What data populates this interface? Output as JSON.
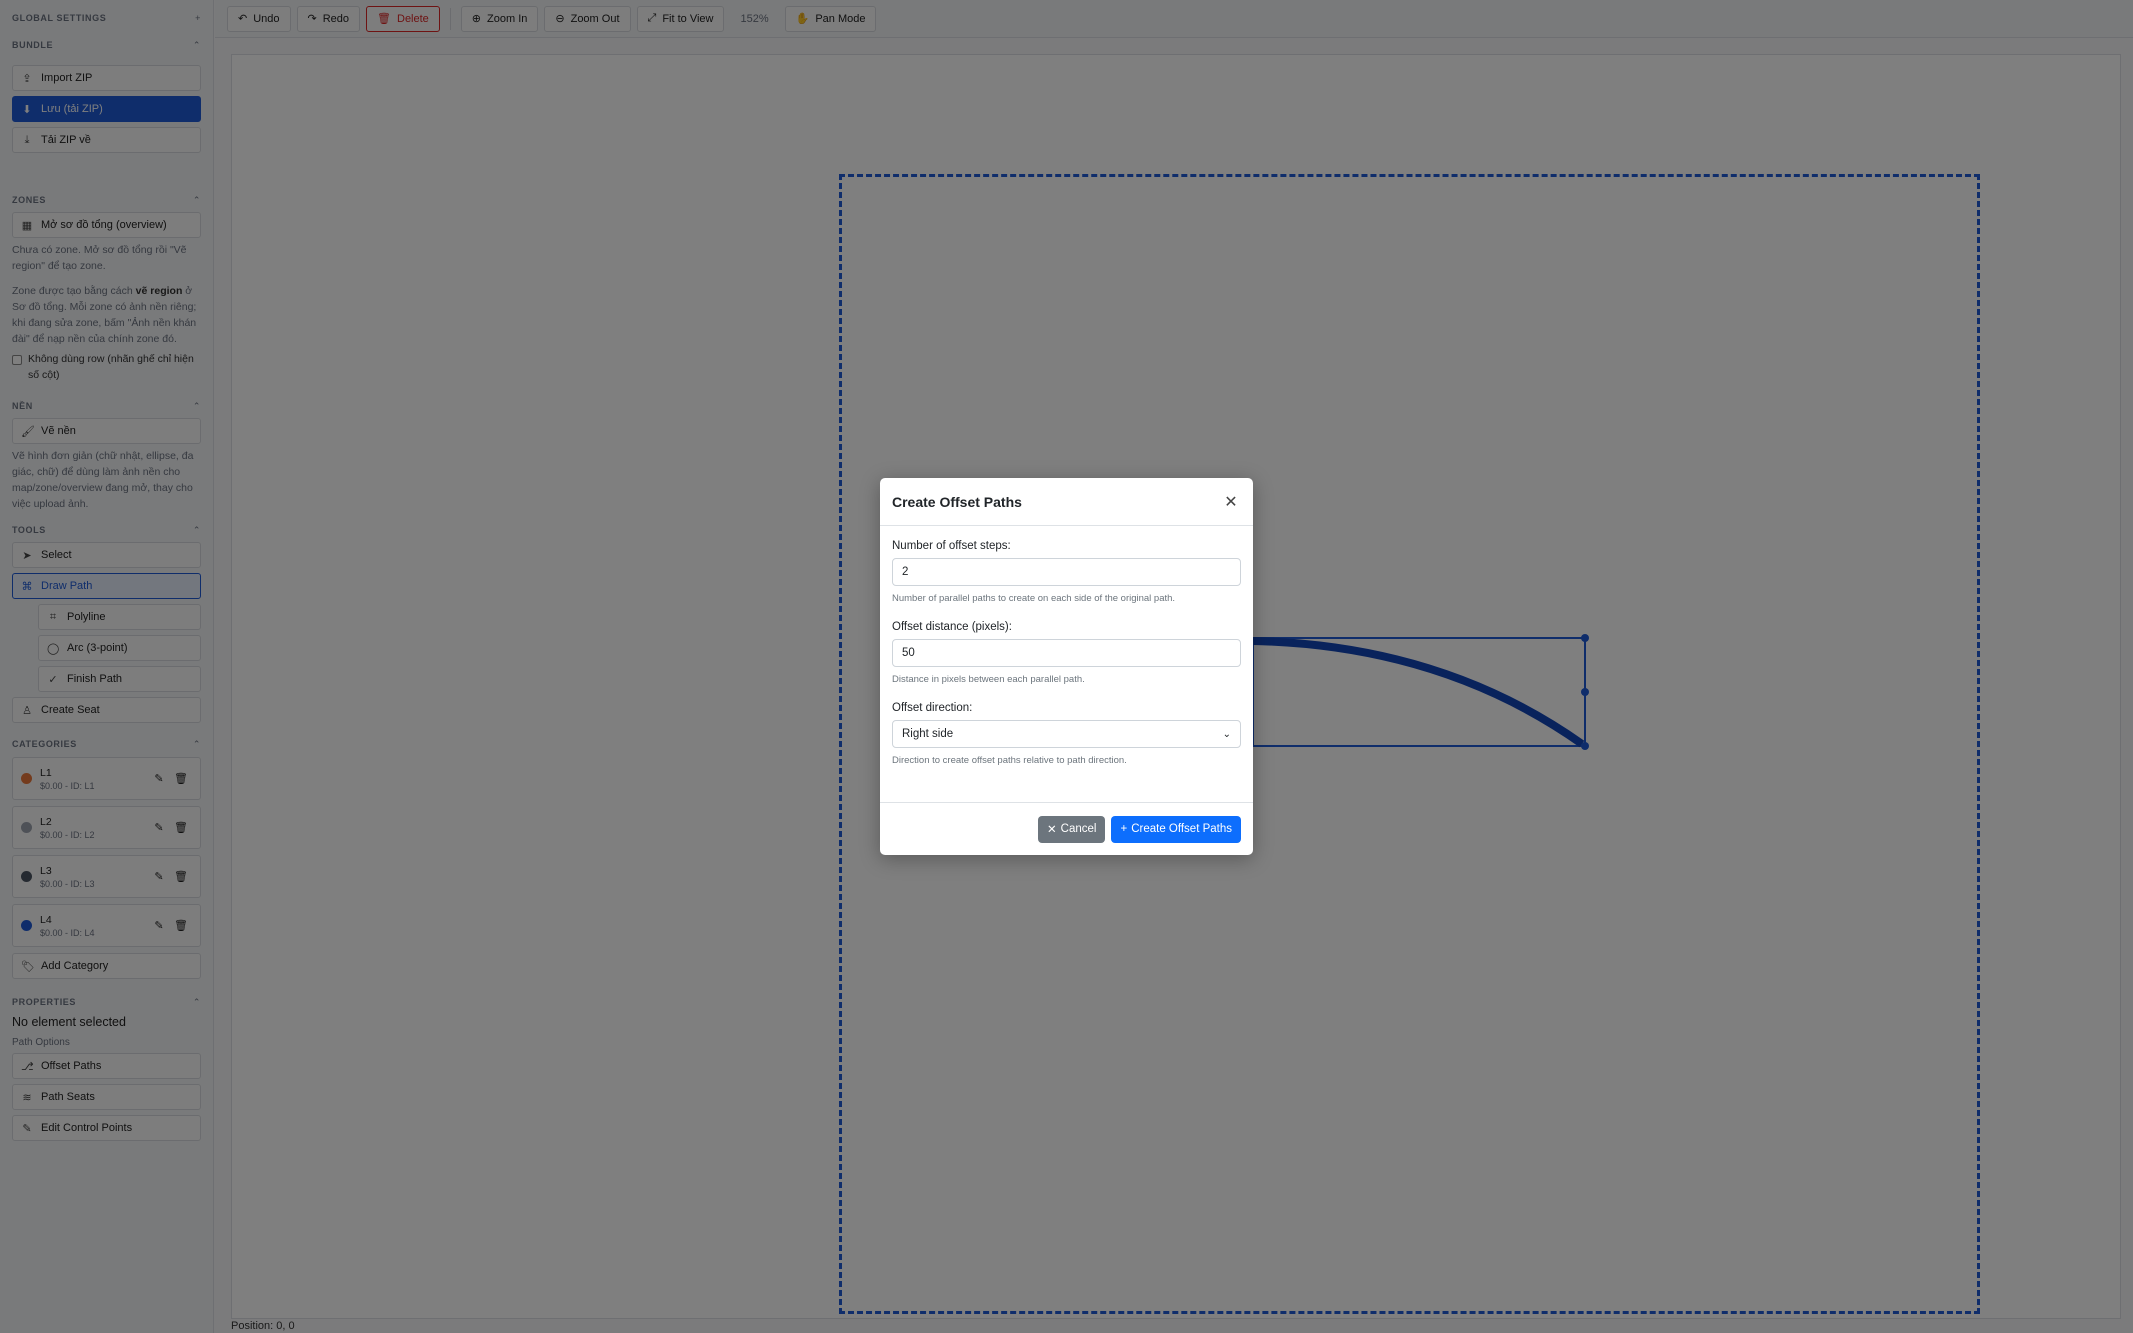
{
  "sidebar": {
    "global_settings": "GLOBAL SETTINGS",
    "bundle": {
      "header": "BUNDLE",
      "import_zip": "Import ZIP",
      "save_zip": "Lưu (tải ZIP)",
      "download_zip": "Tải ZIP về"
    },
    "zones": {
      "header": "ZONES",
      "open_overview": "Mở sơ đồ tổng (overview)",
      "help1": "Chưa có zone. Mở sơ đồ tổng rồi \"Vẽ region\" để tạo zone.",
      "help2_a": "Zone được tạo bằng cách ",
      "help2_b": "vẽ region",
      "help2_c": " ở Sơ đồ tổng. Mỗi zone có ảnh nền riêng; khi đang sửa zone, bấm \"Ảnh nền khán đài\" để nạp nền của chính zone đó.",
      "no_row_label": "Không dùng row (nhãn ghế chỉ hiện số cột)"
    },
    "nen": {
      "header": "NỀN",
      "draw_bg": "Vẽ nền",
      "help": "Vẽ hình đơn giản (chữ nhật, ellipse, đa giác, chữ) để dùng làm ảnh nền cho map/zone/overview đang mở, thay cho việc upload ảnh."
    },
    "tools": {
      "header": "TOOLS",
      "select": "Select",
      "draw_path": "Draw Path",
      "polyline": "Polyline",
      "arc": "Arc (3-point)",
      "finish_path": "Finish Path",
      "create_seat": "Create Seat"
    },
    "categories": {
      "header": "CATEGORIES",
      "items": [
        {
          "name": "L1",
          "sub": "$0.00 - ID: L1",
          "color": "#e8763a"
        },
        {
          "name": "L2",
          "sub": "$0.00 - ID: L2",
          "color": "#9ca3af"
        },
        {
          "name": "L3",
          "sub": "$0.00 - ID: L3",
          "color": "#4b5563"
        },
        {
          "name": "L4",
          "sub": "$0.00 - ID: L4",
          "color": "#1f5bd7"
        }
      ],
      "add": "Add Category"
    },
    "properties": {
      "header": "PROPERTIES",
      "none_selected": "No element selected",
      "path_options": "Path Options",
      "offset_paths": "Offset Paths",
      "path_seats": "Path Seats",
      "edit_control_points": "Edit Control Points"
    }
  },
  "toolbar": {
    "undo": "Undo",
    "redo": "Redo",
    "delete": "Delete",
    "zoom_in": "Zoom In",
    "zoom_out": "Zoom Out",
    "fit": "Fit to View",
    "zoom_level": "152%",
    "pan": "Pan Mode"
  },
  "status": {
    "position": "Position: 0, 0"
  },
  "modal": {
    "title": "Create Offset Paths",
    "steps_label": "Number of offset steps:",
    "steps_value": "2",
    "steps_help": "Number of parallel paths to create on each side of the original path.",
    "distance_label": "Offset distance (pixels):",
    "distance_value": "50",
    "distance_help": "Distance in pixels between each parallel path.",
    "direction_label": "Offset direction:",
    "direction_value": "Right side",
    "direction_help": "Direction to create offset paths relative to path direction.",
    "cancel": "Cancel",
    "create": "Create Offset Paths"
  },
  "colors": {
    "accent": "#1f5bd7",
    "bootstrap_primary": "#0d6efd",
    "bootstrap_secondary": "#6c757d",
    "danger": "#dc2626"
  }
}
